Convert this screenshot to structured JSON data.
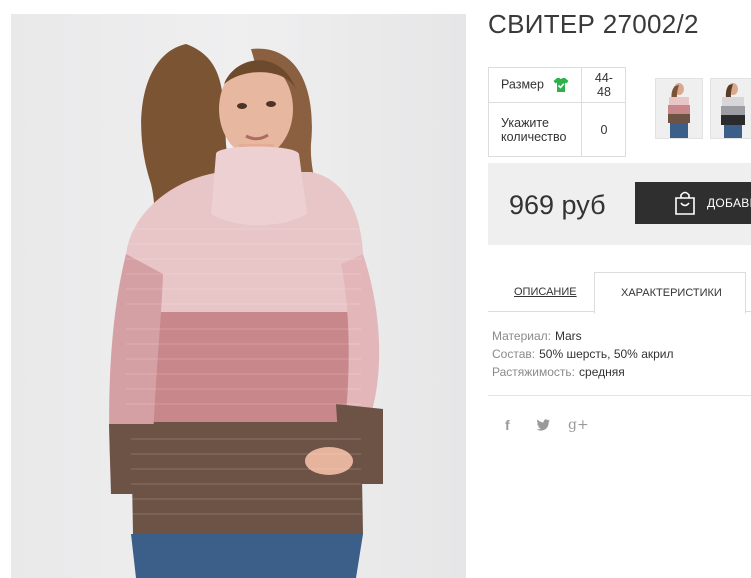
{
  "product": {
    "title": "СВИТЕР 27002/2",
    "image_alt": "woman wearing striped turtleneck sweater"
  },
  "options": {
    "size_label": "Размер",
    "size_value": "44-48",
    "qty_label_line1": "Укажите",
    "qty_label_line2": "количество",
    "qty_value": "0"
  },
  "price": {
    "text": "969 руб"
  },
  "cart": {
    "label": "ДОБАВИТЬ В КОРЗИНУ"
  },
  "tabs": [
    {
      "label": "ОПИСАНИЕ",
      "active": false
    },
    {
      "label": "ХАРАКТЕРИСТИКИ",
      "active": true
    }
  ],
  "specs": [
    {
      "key": "Материал:",
      "value": "Mars"
    },
    {
      "key": "Состав:",
      "value": "50% шерсть, 50% акрил"
    },
    {
      "key": "Растяжимость:",
      "value": "средняя"
    }
  ],
  "social": [
    {
      "glyph": "f",
      "icon": "facebook-icon"
    },
    {
      "glyph": "t",
      "icon": "twitter-icon"
    },
    {
      "glyph": "g+",
      "icon": "google-plus-icon"
    }
  ],
  "colors": {
    "size_icon": "#2db24a",
    "button_bg": "#2f2f2f",
    "price_bg": "#efefef",
    "sweater_light": "#e9c7c9",
    "sweater_mid": "#c9868a",
    "sweater_dark": "#6e5447"
  }
}
